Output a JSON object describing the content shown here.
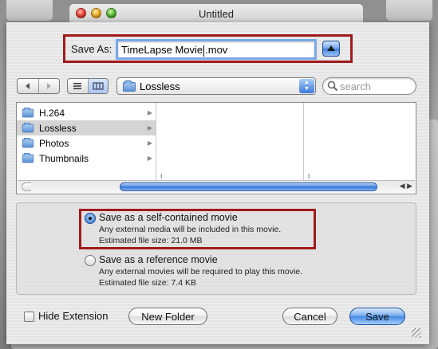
{
  "window": {
    "title": "Untitled"
  },
  "save_as": {
    "label": "Save As:",
    "filename_before_caret": "TimeLapse Movie",
    "filename_after_caret": ".mov"
  },
  "location": {
    "current_folder": "Lossless"
  },
  "search": {
    "placeholder": "search"
  },
  "browser": {
    "items": [
      {
        "label": "H.264",
        "selected": false
      },
      {
        "label": "Lossless",
        "selected": true
      },
      {
        "label": "Photos",
        "selected": false
      },
      {
        "label": "Thumbnails",
        "selected": false
      }
    ],
    "scroll_position": 0.93
  },
  "options": {
    "selected": "self_contained",
    "self_contained": {
      "title": "Save as a self-contained movie",
      "desc": "Any external media will be included in this movie.",
      "size": "Estimated file size:  21.0 MB"
    },
    "reference": {
      "title": "Save as a reference movie",
      "desc": "Any external movies will be required to play this movie.",
      "size": "Estimated file size:  7.4 KB"
    }
  },
  "footer": {
    "hide_extension_label": "Hide Extension",
    "hide_extension_checked": false,
    "new_folder_label": "New Folder",
    "cancel_label": "Cancel",
    "save_label": "Save"
  },
  "colors": {
    "highlight_box": "#a01a1a",
    "aqua_blue": "#4288e3"
  }
}
